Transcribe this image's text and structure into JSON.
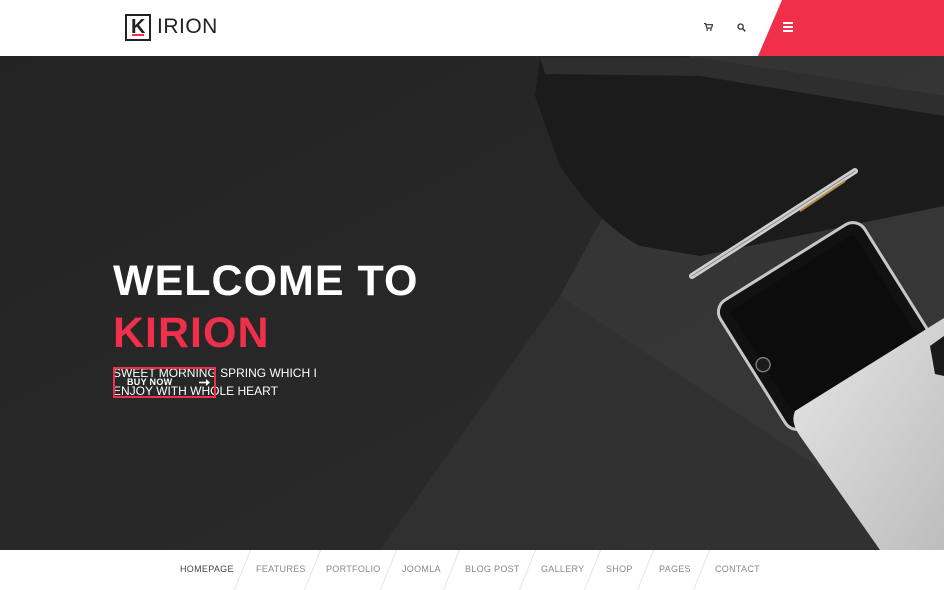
{
  "header": {
    "logo_letter": "K",
    "logo_text": "IRION",
    "icons": [
      "cart-icon",
      "search-icon",
      "hamburger-menu-icon"
    ]
  },
  "hero": {
    "title_line1": "WELCOME TO",
    "title_line2": "KIRION",
    "subtitle_line1": "SWEET MORNING SPRING WHICH I",
    "subtitle_line2": "ENJOY WITH WHOLE HEART",
    "cta_label": "BUY NOW",
    "cta_icon": "arrow-right-icon"
  },
  "nav": {
    "items": [
      "HOMEPAGE",
      "FEATURES",
      "PORTFOLIO",
      "JOOMLA",
      "BLOG POST",
      "GALLERY",
      "SHOP",
      "PAGES",
      "CONTACT"
    ],
    "active": "HOMEPAGE"
  },
  "colors": {
    "accent": "#f0304a",
    "hero_background": "#2a2a2a",
    "header_background": "#ffffff",
    "nav_text": "#888888"
  }
}
